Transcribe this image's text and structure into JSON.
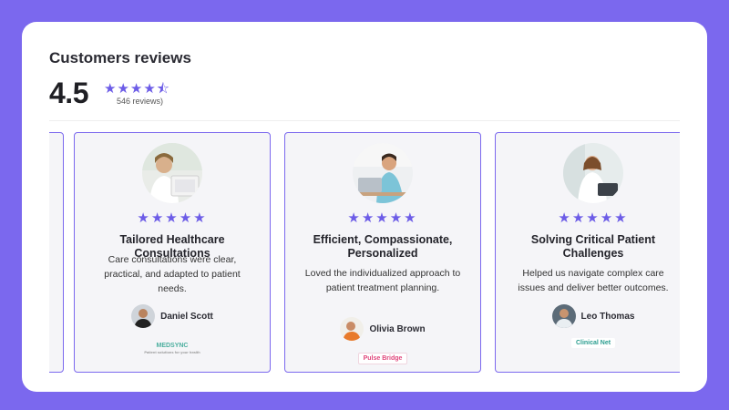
{
  "header": {
    "title": "Customers reviews",
    "score": "4.5",
    "stars": "★★★★⯪",
    "count": "546 reviews)"
  },
  "reviews": [
    {
      "stars": "★★★★★",
      "title": "Tailored Healthcare Consultations",
      "text": "Care consultations were clear, practical, and adapted to patient needs.",
      "author": "Daniel Scott",
      "logo": "MEDSYNC",
      "logo_sub": "Patient solutions for your health"
    },
    {
      "stars": "★★★★★",
      "title": "Efficient, Compassionate, Personalized",
      "text": "Loved the individualized approach to patient treatment planning.",
      "author": "Olivia Brown",
      "logo": "Pulse Bridge"
    },
    {
      "stars": "★★★★★",
      "title": "Solving Critical Patient Challenges",
      "text": "Helped us navigate complex care issues and deliver better outcomes.",
      "author": "Leo Thomas",
      "logo": "Clinical Net"
    }
  ],
  "colors": {
    "accent": "#7B68EE",
    "star": "#6C5CE7",
    "card_bg": "#F5F5F8"
  }
}
